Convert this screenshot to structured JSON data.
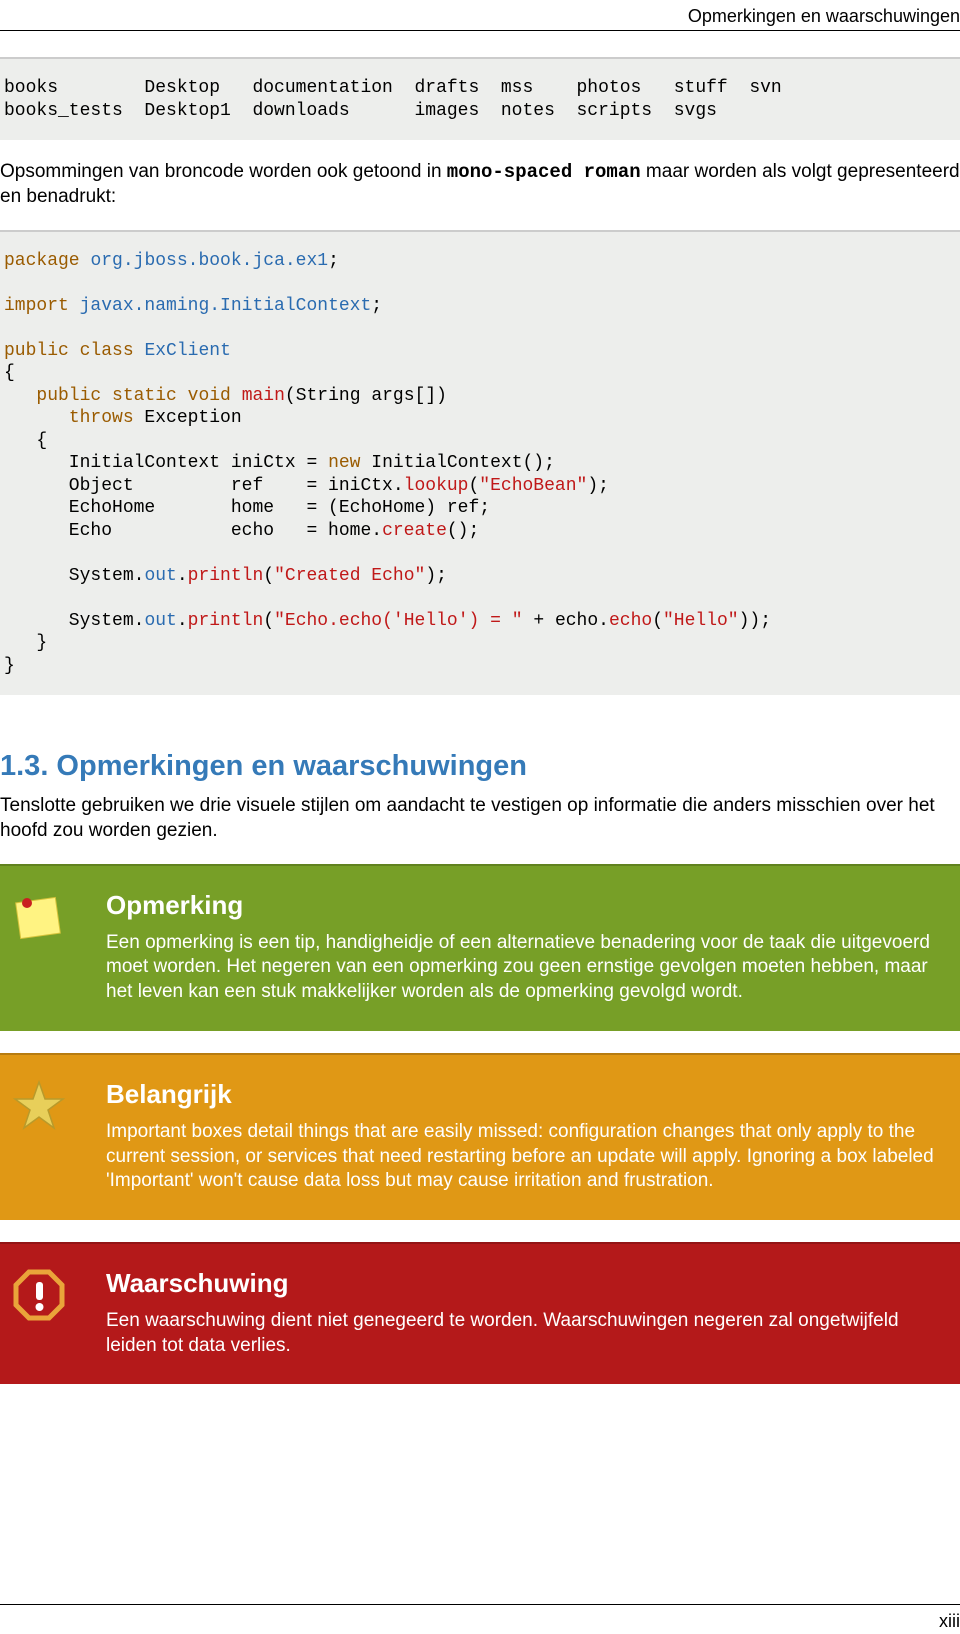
{
  "header": {
    "running_title": "Opmerkingen en waarschuwingen"
  },
  "codeblock_dir": "books        Desktop   documentation  drafts  mss    photos   stuff  svn\nbooks_tests  Desktop1  downloads      images  notes  scripts  svgs",
  "para1": {
    "pre": "Opsommingen van broncode worden ook getoond in ",
    "mono": "mono-spaced roman",
    "post": " maar worden als volgt gepresenteerd en benadrukt:"
  },
  "section": {
    "heading": "1.3. Opmerkingen en waarschuwingen",
    "body": "Tenslotte gebruiken we drie visuele stijlen om aandacht te vestigen op informatie die anders misschien over het hoofd zou worden gezien."
  },
  "admonitions": {
    "note": {
      "title": "Opmerking",
      "body": "Een opmerking is een tip, handigheidje of een alternatieve benadering voor de taak die uitgevoerd moet worden. Het negeren van een opmerking zou geen ernstige gevolgen moeten hebben, maar het leven kan een stuk makkelijker worden als de opmerking gevolgd wordt."
    },
    "important": {
      "title": "Belangrijk",
      "body": "Important boxes detail things that are easily missed: configuration changes that only apply to the current session, or services that need restarting before an update will apply. Ignoring a box labeled 'Important' won't cause data loss but may cause irritation and frustration."
    },
    "warning": {
      "title": "Waarschuwing",
      "body": "Een waarschuwing dient niet genegeerd te worden. Waarschuwingen negeren zal ongetwijfeld leiden tot data verlies."
    }
  },
  "footer": {
    "page_number": "xiii"
  },
  "code": {
    "kw": {
      "package": "package",
      "import": "import",
      "public": "public",
      "class": "class",
      "static": "static",
      "void": "void",
      "throws": "throws",
      "new": "new"
    },
    "pkg": "org.jboss.book.jca.ex1",
    "imp": "javax.naming.InitialContext",
    "cls": "ExClient",
    "main": "main",
    "args": "(String args[])",
    "exc": " Exception",
    "l1a": "      InitialContext iniCtx = ",
    "l1b": " InitialContext();",
    "l2a": "      Object         ref    = iniCtx.",
    "l2_lookup": "lookup",
    "l2b": "(",
    "l2_str": "\"EchoBean\"",
    "l2c": ");",
    "l3": "      EchoHome       home   = (EchoHome) ref;",
    "l4a": "      Echo           echo   = home.",
    "l4_create": "create",
    "l4b": "();",
    "outA": "      System.",
    "out": "out",
    "dot": ".",
    "println": "println",
    "p1_open": "(",
    "p1_str": "\"Created Echo\"",
    "p1_close": ");",
    "p2_open": "(",
    "p2_str1": "\"Echo.echo('Hello') = \"",
    "p2_plus": " + echo.",
    "p2_echo": "echo",
    "p2_open2": "(",
    "p2_str2": "\"Hello\"",
    "p2_close": "));",
    "brace_open": "{",
    "brace_close": "}",
    "brace_close_indent": "   }",
    "indent_brace_open": "   {",
    "semicolon": ";",
    "throws_indent": "      "
  }
}
